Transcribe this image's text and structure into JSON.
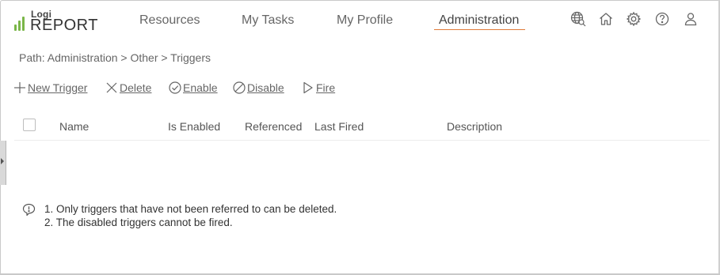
{
  "app": {
    "logo_top": "Logi",
    "logo_main": "REPORT",
    "brand_color": "#7ab648"
  },
  "nav": {
    "items": [
      {
        "label": "Resources"
      },
      {
        "label": "My Tasks"
      },
      {
        "label": "My Profile"
      },
      {
        "label": "Administration",
        "active": true
      }
    ],
    "active_color": "#e07b39"
  },
  "header_icons": [
    "globe-search-icon",
    "home-icon",
    "gear-icon",
    "help-icon",
    "user-icon"
  ],
  "breadcrumb": {
    "text": "Path: Administration > Other > Triggers"
  },
  "toolbar": {
    "new_trigger": "New Trigger",
    "delete": "Delete",
    "enable": "Enable",
    "disable": "Disable",
    "fire": "Fire"
  },
  "table": {
    "columns": [
      "Name",
      "Is Enabled",
      "Referenced",
      "Last Fired",
      "Description"
    ],
    "rows": []
  },
  "notes": {
    "line1": "1. Only triggers that have not been referred to can be deleted.",
    "line2": "2. The disabled triggers cannot be fired."
  }
}
